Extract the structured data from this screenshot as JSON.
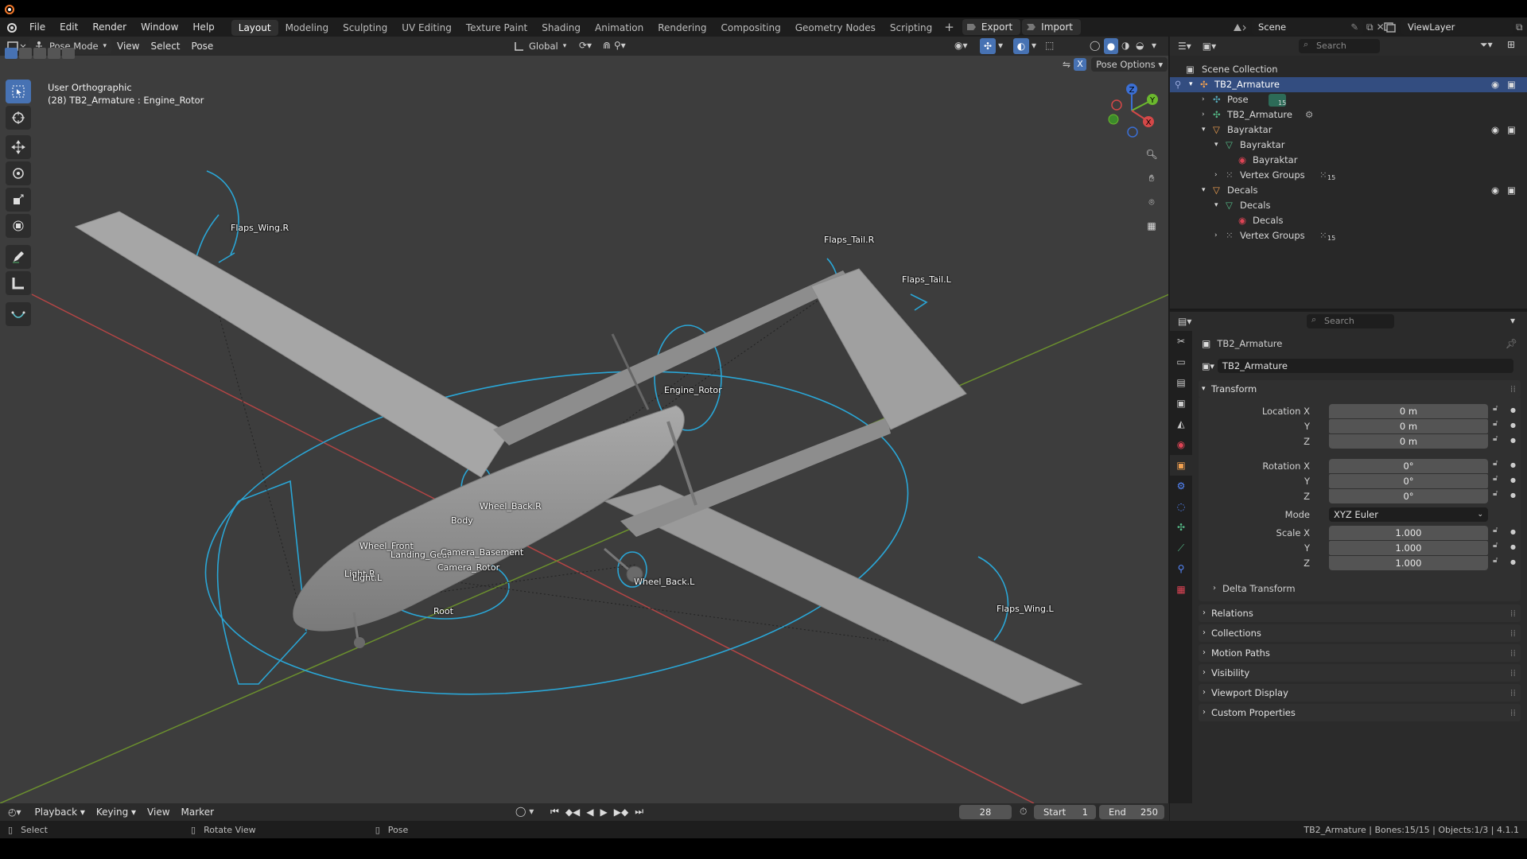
{
  "menu": {
    "file": "File",
    "edit": "Edit",
    "render": "Render",
    "window": "Window",
    "help": "Help"
  },
  "workspaces": [
    "Layout",
    "Modeling",
    "Sculpting",
    "UV Editing",
    "Texture Paint",
    "Shading",
    "Animation",
    "Rendering",
    "Compositing",
    "Geometry Nodes",
    "Scripting"
  ],
  "topbar": {
    "export_label": "Export",
    "import_label": "Import",
    "scene": "Scene",
    "view_layer": "ViewLayer"
  },
  "viewport": {
    "mode": "Pose Mode",
    "menus": [
      "View",
      "Select",
      "Pose"
    ],
    "orientation": "Global",
    "pose_options": "Pose Options",
    "x_mirror": "X",
    "view_name": "User Orthographic",
    "active_info": "(28) TB2_Armature : Engine_Rotor",
    "gizmo": {
      "z": "Z",
      "y": "Y",
      "x": "X"
    },
    "bones": [
      "Flaps_Wing.R",
      "Flaps_Tail.R",
      "Flaps_Tail.L",
      "Engine_Rotor",
      "Wheel_Back.R",
      "Body",
      "Wheel_Front",
      "Landing_Gear",
      "Camera_Basement",
      "Camera_Rotor",
      "Light.R",
      "Light.L",
      "Wheel_Back.L",
      "Root",
      "Flaps_Wing.L"
    ]
  },
  "outliner": {
    "search_placeholder": "Search",
    "root": "Scene Collection",
    "rows": [
      {
        "label": "TB2_Armature"
      },
      {
        "label": "Pose"
      },
      {
        "label": "TB2_Armature"
      },
      {
        "label": "Bayraktar"
      },
      {
        "label": "Bayraktar"
      },
      {
        "label": "Bayraktar"
      },
      {
        "label": "Vertex Groups"
      },
      {
        "label": "Decals"
      },
      {
        "label": "Decals"
      },
      {
        "label": "Decals"
      },
      {
        "label": "Vertex Groups"
      }
    ],
    "badge_count": "15"
  },
  "properties": {
    "search_placeholder": "Search",
    "object_name": "TB2_Armature",
    "datablock": "TB2_Armature",
    "transform_label": "Transform",
    "location": {
      "label": "Location X",
      "x": "0 m",
      "y": "0 m",
      "z": "0 m"
    },
    "rotation": {
      "label": "Rotation X",
      "x": "0°",
      "y": "0°",
      "z": "0°"
    },
    "mode": {
      "label": "Mode",
      "value": "XYZ Euler"
    },
    "scale": {
      "label": "Scale X",
      "x": "1.000",
      "y": "1.000",
      "z": "1.000"
    },
    "axis_y": "Y",
    "axis_z": "Z",
    "delta": "Delta Transform",
    "panels": [
      "Relations",
      "Collections",
      "Motion Paths",
      "Visibility",
      "Viewport Display",
      "Custom Properties"
    ]
  },
  "timeline": {
    "menus": [
      "Playback",
      "Keying",
      "View",
      "Marker"
    ],
    "current_frame": "28",
    "start_label": "Start",
    "start": "1",
    "end_label": "End",
    "end": "250"
  },
  "status": {
    "select": "Select",
    "rotate": "Rotate View",
    "pose": "Pose",
    "info": "TB2_Armature | Bones:15/15 | Objects:1/3 | 4.1.1"
  },
  "colors": {
    "accent": "#4772b3",
    "bone_wire": "#2aa6d6",
    "selected_row": "#334d80"
  }
}
